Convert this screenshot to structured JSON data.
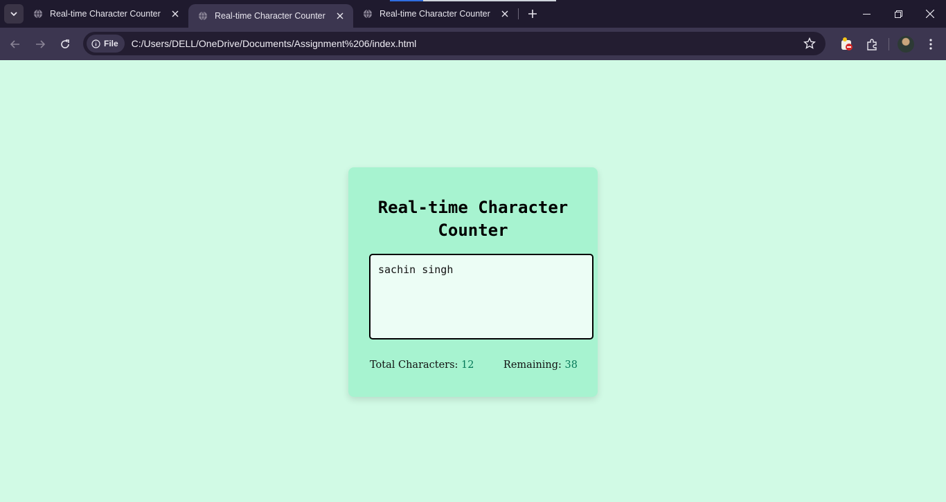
{
  "browser": {
    "tabs": [
      {
        "title": "Real-time Character Counter",
        "active": false
      },
      {
        "title": "Real-time Character Counter",
        "active": true
      },
      {
        "title": "Real-time Character Counter",
        "active": false
      }
    ],
    "site_chip": "File",
    "url": "C:/Users/DELL/OneDrive/Documents/Assignment%206/index.html"
  },
  "page": {
    "heading": "Real-time Character Counter",
    "textarea_value": "sachin singh",
    "total_label": "Total Characters:",
    "total_value": "12",
    "remaining_label": "Remaining:",
    "remaining_value": "38"
  },
  "colors": {
    "page_bg": "#d1fae5",
    "card_bg": "#a7f3d0",
    "textarea_bg": "#ecfdf5",
    "count_color": "#047857"
  }
}
